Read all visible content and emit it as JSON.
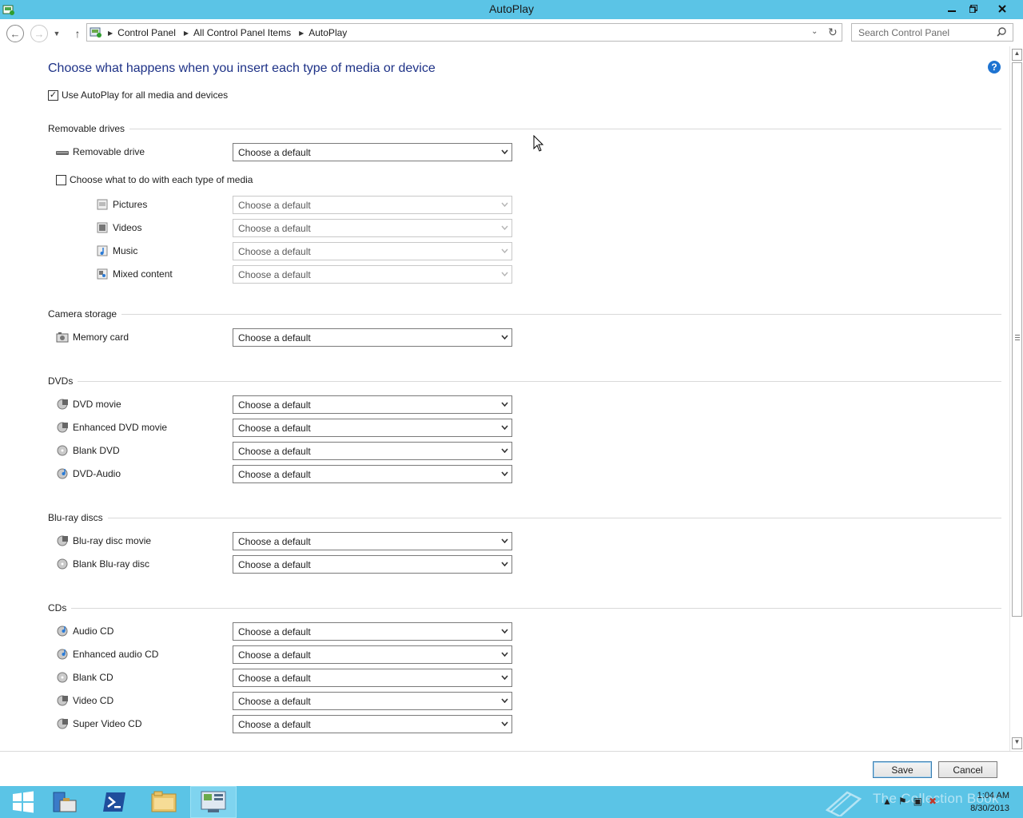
{
  "window": {
    "title": "AutoPlay",
    "minimize_icon": "minimize-icon",
    "restore_icon": "restore-icon",
    "close_icon": "close-icon"
  },
  "navbar": {
    "breadcrumbs": [
      "Control Panel",
      "All Control Panel Items",
      "AutoPlay"
    ],
    "search_placeholder": "Search Control Panel"
  },
  "main": {
    "heading": "Choose what happens when you insert each type of media or device",
    "use_autoplay": {
      "label": "Use AutoPlay for all media and devices",
      "checked": true
    },
    "removable_drives": {
      "title": "Removable drives",
      "removable_drive": {
        "label": "Removable drive",
        "value": "Choose a default"
      },
      "per_media": {
        "label": "Choose what to do with each type of media",
        "checked": false
      },
      "media": [
        {
          "label": "Pictures",
          "value": "Choose a default"
        },
        {
          "label": "Videos",
          "value": "Choose a default"
        },
        {
          "label": "Music",
          "value": "Choose a default"
        },
        {
          "label": "Mixed content",
          "value": "Choose a default"
        }
      ]
    },
    "camera_storage": {
      "title": "Camera storage",
      "items": [
        {
          "label": "Memory card",
          "value": "Choose a default"
        }
      ]
    },
    "dvds": {
      "title": "DVDs",
      "items": [
        {
          "label": "DVD movie",
          "value": "Choose a default"
        },
        {
          "label": "Enhanced DVD movie",
          "value": "Choose a default"
        },
        {
          "label": "Blank DVD",
          "value": "Choose a default"
        },
        {
          "label": "DVD-Audio",
          "value": "Choose a default"
        }
      ]
    },
    "bluray": {
      "title": "Blu-ray discs",
      "items": [
        {
          "label": "Blu-ray disc movie",
          "value": "Choose a default"
        },
        {
          "label": "Blank Blu-ray disc",
          "value": "Choose a default"
        }
      ]
    },
    "cds": {
      "title": "CDs",
      "items": [
        {
          "label": "Audio CD",
          "value": "Choose a default"
        },
        {
          "label": "Enhanced audio CD",
          "value": "Choose a default"
        },
        {
          "label": "Blank CD",
          "value": "Choose a default"
        },
        {
          "label": "Video CD",
          "value": "Choose a default"
        },
        {
          "label": "Super Video CD",
          "value": "Choose a default"
        }
      ]
    }
  },
  "footer": {
    "save_label": "Save",
    "cancel_label": "Cancel"
  },
  "taskbar": {
    "time": "1:04 AM",
    "date": "8/30/2013",
    "watermark": "The Collection Book"
  },
  "colors": {
    "accent": "#5bc4e6",
    "heading": "#1e3287",
    "help": "#1e73d1"
  }
}
